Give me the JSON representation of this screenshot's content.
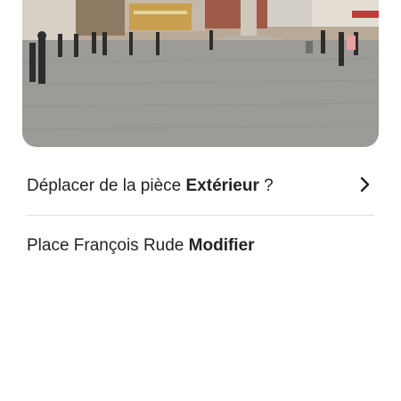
{
  "photo": {
    "icon": "photo-image",
    "description_colors": {
      "sky": "#c9d4de",
      "pavement": "#9a9a98"
    }
  },
  "move_row": {
    "prefix": "Déplacer de la pièce ",
    "room": "Extérieur",
    "suffix": " ?",
    "icon": "chevron-right-icon"
  },
  "place_row": {
    "name": "Place François Rude",
    "separator": " ",
    "action": "Modifier"
  },
  "colors": {
    "text": "#222222",
    "divider": "#dddddd",
    "background": "#ffffff"
  }
}
